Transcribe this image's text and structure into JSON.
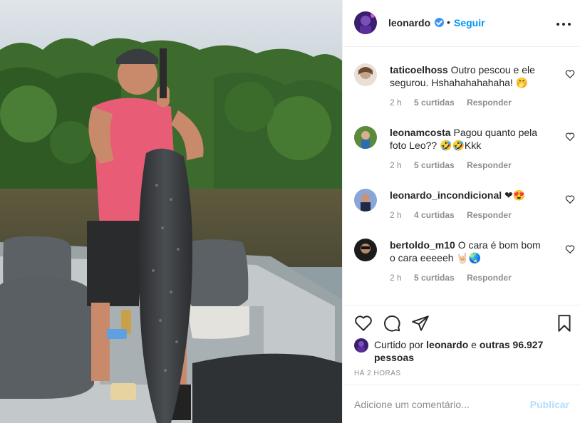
{
  "post": {
    "author": "leonardo",
    "follow_label": "Seguir",
    "separator": "•"
  },
  "comments": [
    {
      "user": "taticoelhoss",
      "text": "Outro pescou e ele segurou. Hshahahahahaha! 🤭",
      "time": "2 h",
      "likes": "5 curtidas",
      "reply": "Responder"
    },
    {
      "user": "leonamcosta",
      "text": "Pagou quanto pela foto Leo?? 🤣🤣Kkk",
      "time": "2 h",
      "likes": "5 curtidas",
      "reply": "Responder"
    },
    {
      "user": "leonardo_incondicional",
      "text": "❤😍",
      "time": "2 h",
      "likes": "4 curtidas",
      "reply": "Responder"
    },
    {
      "user": "bertoldo_m10",
      "text": "O cara é bom bom o cara eeeeeh 🤘🏻🌏",
      "time": "2 h",
      "likes": "5 curtidas",
      "reply": "Responder"
    }
  ],
  "likes": {
    "prefix": "Curtido por",
    "user": "leonardo",
    "conj": "e",
    "others": "outras 96.927 pessoas"
  },
  "time_ago": "HÁ 2 HORAS",
  "add_comment": {
    "placeholder": "Adicione um comentário...",
    "publish_label": "Publicar"
  },
  "icons": {
    "verified": "verified-badge-icon",
    "more": "more-options-icon",
    "like": "heart-icon",
    "comment": "comment-bubble-icon",
    "share": "paper-plane-icon",
    "save": "bookmark-icon"
  },
  "colors": {
    "accent": "#0095f6",
    "muted": "#8e8e8e",
    "publish_disabled": "#b2dffc"
  }
}
